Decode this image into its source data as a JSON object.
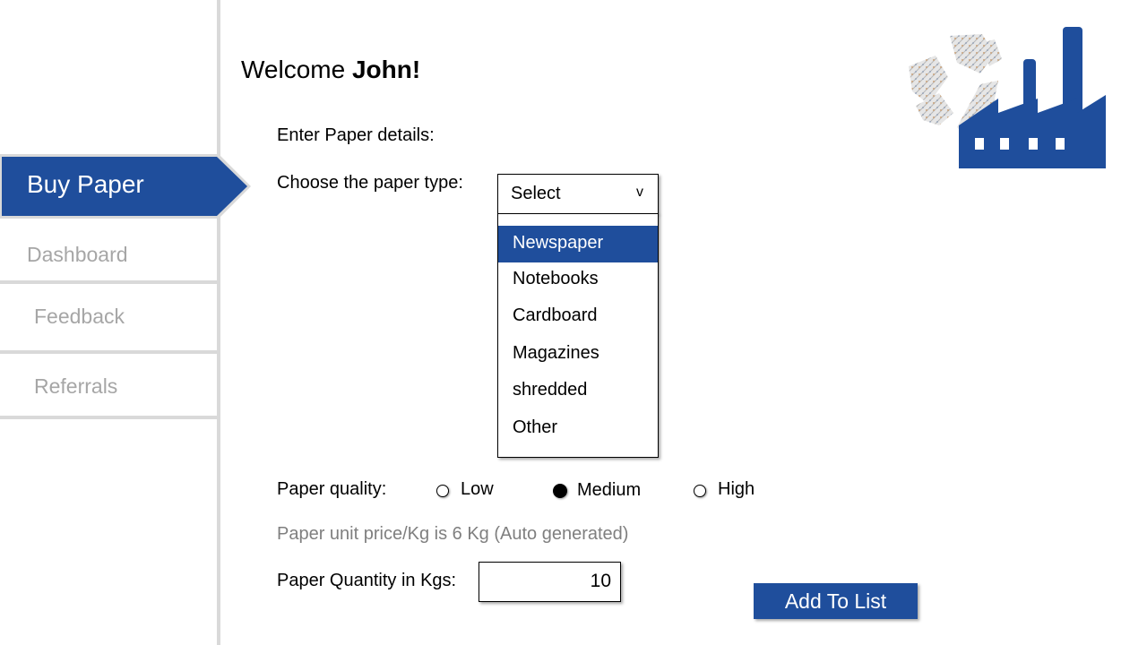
{
  "sidebar": {
    "active_item": "Buy Paper",
    "items": [
      {
        "label": "Dashboard"
      },
      {
        "label": "Feedback"
      },
      {
        "label": "Referrals"
      }
    ]
  },
  "header": {
    "welcome_prefix": "Welcome ",
    "user_name": "John!"
  },
  "form": {
    "section_label": "Enter Paper details:",
    "paper_type_label": "Choose the paper type:",
    "paper_type_select": {
      "value": "Select",
      "chevron": "v",
      "options": [
        "Newspaper",
        "Notebooks",
        "Cardboard",
        "Magazines",
        "shredded",
        "Other"
      ],
      "highlighted": "Newspaper"
    },
    "quality_label": "Paper quality:",
    "quality_options": [
      {
        "label": "Low",
        "selected": false
      },
      {
        "label": "Medium",
        "selected": true
      },
      {
        "label": "High",
        "selected": false
      }
    ],
    "unit_price_text": "Paper unit price/Kg is 6 Kg (Auto generated)",
    "quantity_label": "Paper Quantity in Kgs:",
    "quantity_value": "10",
    "add_button_label": "Add To List"
  },
  "logo": {
    "icon": "recycling-factory-icon"
  },
  "colors": {
    "accent": "#1f4e9c",
    "muted_text": "#a6a6a6",
    "divider": "#d9d9d9"
  }
}
